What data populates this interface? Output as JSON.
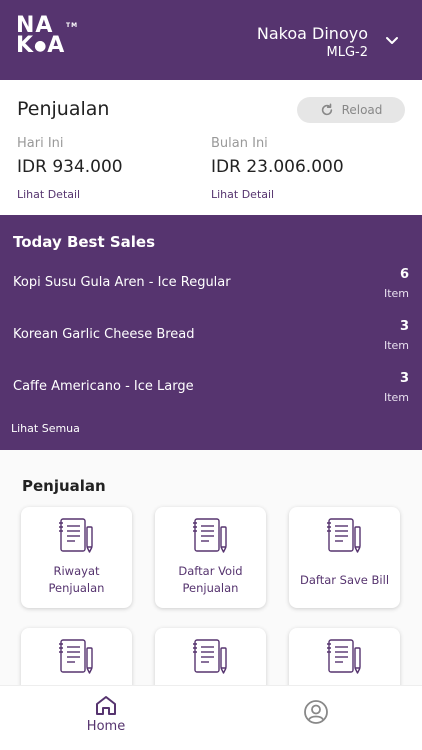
{
  "header": {
    "logo_line1": "NA",
    "logo_line2": "K•A",
    "logo_text": "NAKOA",
    "store_name": "Nakoa Dinoyo",
    "store_code": "MLG-2",
    "accent": "#56346f"
  },
  "sales": {
    "title": "Penjualan",
    "reload_label": "Reload",
    "today": {
      "label": "Hari Ini",
      "value": "IDR 934.000",
      "link": "Lihat Detail"
    },
    "month": {
      "label": "Bulan Ini",
      "value": "IDR 23.006.000",
      "link": "Lihat Detail"
    }
  },
  "best_sales": {
    "title": "Today Best Sales",
    "items": [
      {
        "name": "Kopi Susu Gula Aren - Ice Regular",
        "qty": "6",
        "unit": "Item"
      },
      {
        "name": "Korean Garlic Cheese Bread",
        "qty": "3",
        "unit": "Item"
      },
      {
        "name": "Caffe Americano - Ice Large",
        "qty": "3",
        "unit": "Item"
      }
    ],
    "see_all": "Lihat Semua"
  },
  "menu": {
    "title": "Penjualan",
    "tiles": [
      {
        "line1": "Riwayat",
        "line2": "Penjualan",
        "icon": "document-pen-icon"
      },
      {
        "line1": "Daftar Void",
        "line2": "Penjualan",
        "icon": "document-pen-icon"
      },
      {
        "line1": "Daftar Save Bill",
        "line2": "",
        "icon": "document-pen-icon"
      },
      {
        "line1": "",
        "line2": "",
        "icon": "document-pen-icon"
      },
      {
        "line1": "",
        "line2": "",
        "icon": "document-pen-icon"
      },
      {
        "line1": "",
        "line2": "",
        "icon": "document-pen-icon"
      }
    ]
  },
  "bottom_nav": {
    "home_label": "Home",
    "home_icon": "home-icon",
    "profile_icon": "profile-icon"
  }
}
